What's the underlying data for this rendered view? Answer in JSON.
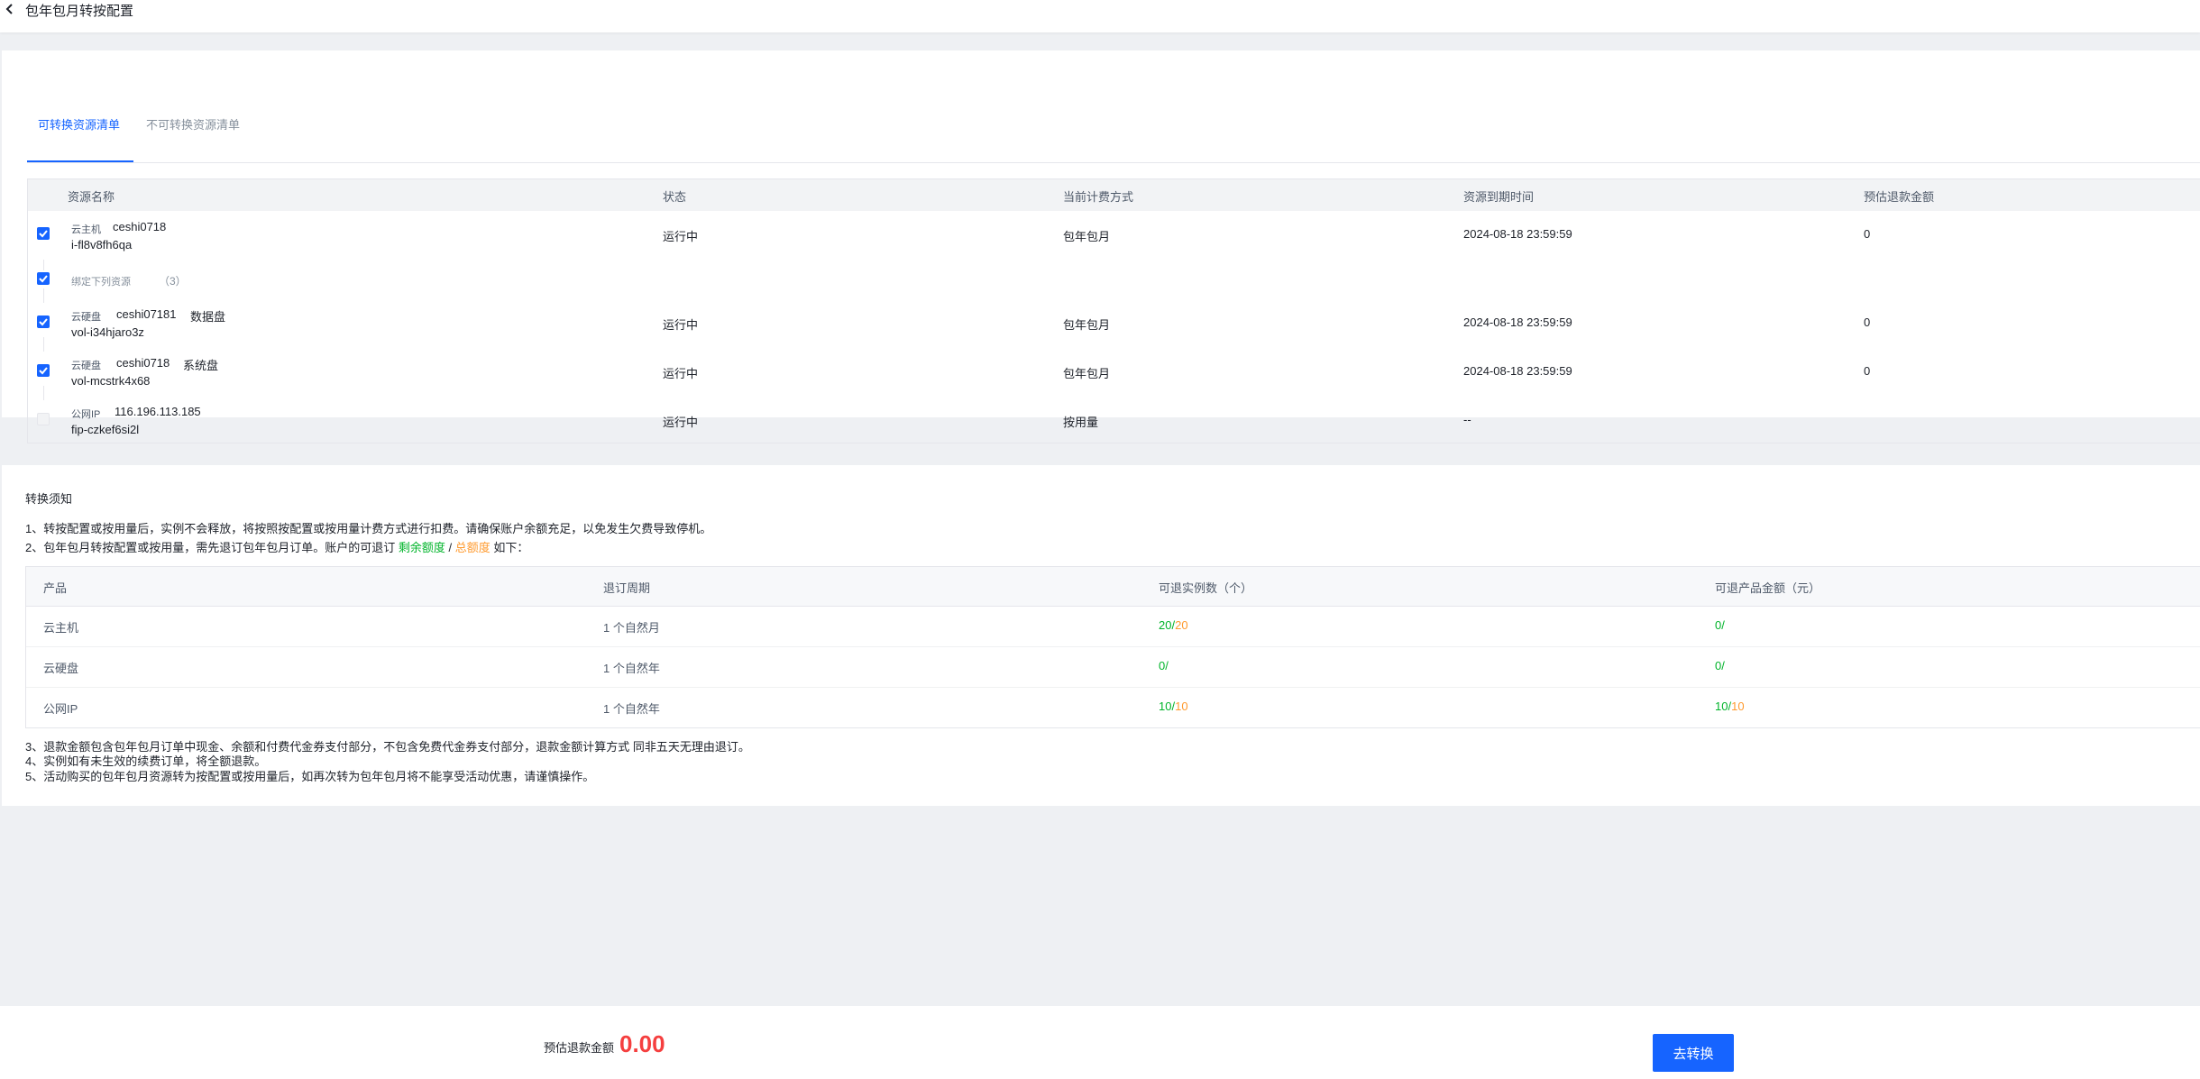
{
  "header": {
    "title": "包年包月转按配置"
  },
  "tabs": [
    {
      "label": "可转换资源清单",
      "active": true
    },
    {
      "label": "不可转换资源清单",
      "active": false
    }
  ],
  "resource_table": {
    "columns": [
      "资源名称",
      "状态",
      "当前计费方式",
      "资源到期时间",
      "预估退款金额"
    ],
    "rows": [
      {
        "type": "云主机",
        "name": "ceshi0718",
        "tag": "",
        "id": "i-fl8v8fh6qa",
        "status": "运行中",
        "billing": "包年包月",
        "expire": "2024-08-18 23:59:59",
        "refund": "0",
        "checked": true,
        "disabled": false
      },
      {
        "type": "云硬盘",
        "name": "ceshi07181",
        "tag": "数据盘",
        "id": "vol-i34hjaro3z",
        "status": "运行中",
        "billing": "包年包月",
        "expire": "2024-08-18 23:59:59",
        "refund": "0",
        "checked": true,
        "disabled": false
      },
      {
        "type": "云硬盘",
        "name": "ceshi0718",
        "tag": "系统盘",
        "id": "vol-mcstrk4x68",
        "status": "运行中",
        "billing": "包年包月",
        "expire": "2024-08-18 23:59:59",
        "refund": "0",
        "checked": true,
        "disabled": false
      },
      {
        "type": "公网IP",
        "name": "116.196.113.185",
        "tag": "",
        "id": "fip-czkef6si2l",
        "status": "运行中",
        "billing": "按用量",
        "expire": "--",
        "refund": "",
        "checked": false,
        "disabled": true
      }
    ],
    "bound_group": {
      "label": "绑定下列资源",
      "count": "（3）",
      "checked": true
    }
  },
  "notice": {
    "title": "转换须知",
    "line1": "1、转按配置或按用量后，实例不会释放，将按照按配置或按用量计费方式进行扣费。请确保账户余额充足，以免发生欠费导致停机。",
    "line2_prefix": "2、包年包月转按配置或按用量，需先退订包年包月订单。账户的可退订",
    "line2_remaining": "剩余额度",
    "line2_sep": "/",
    "line2_total": "总额度",
    "line2_suffix": "如下：",
    "quota_table": {
      "columns": [
        "产品",
        "退订周期",
        "可退实例数（个）",
        "可退产品金额（元）"
      ],
      "rows": [
        {
          "product": "云主机",
          "period": "1 个自然月",
          "inst_remaining": "20",
          "inst_total": "20",
          "amt_remaining": "0",
          "amt_total": ""
        },
        {
          "product": "云硬盘",
          "period": "1 个自然年",
          "inst_remaining": "0",
          "inst_total": "",
          "amt_remaining": "0",
          "amt_total": ""
        },
        {
          "product": "公网IP",
          "period": "1 个自然年",
          "inst_remaining": "10",
          "inst_total": "10",
          "amt_remaining": "10",
          "amt_total": "10"
        }
      ]
    },
    "line3": "3、退款金额包含包年包月订单中现金、余额和付费代金券支付部分，不包含免费代金券支付部分，退款金额计算方式 同非五天无理由退订。",
    "line4": "4、实例如有未生效的续费订单，将全额退款。",
    "line5": "5、活动购买的包年包月资源转为按配置或按用量后，如再次转为包年包月将不能享受活动优惠，请谨慎操作。"
  },
  "footer": {
    "refund_label": "预估退款金额",
    "refund_value": "0.00",
    "convert_button": "去转换"
  },
  "colors": {
    "primary": "#1664ff",
    "green": "#00b42a",
    "orange": "#ff9a2e",
    "red": "#f53f3f"
  }
}
